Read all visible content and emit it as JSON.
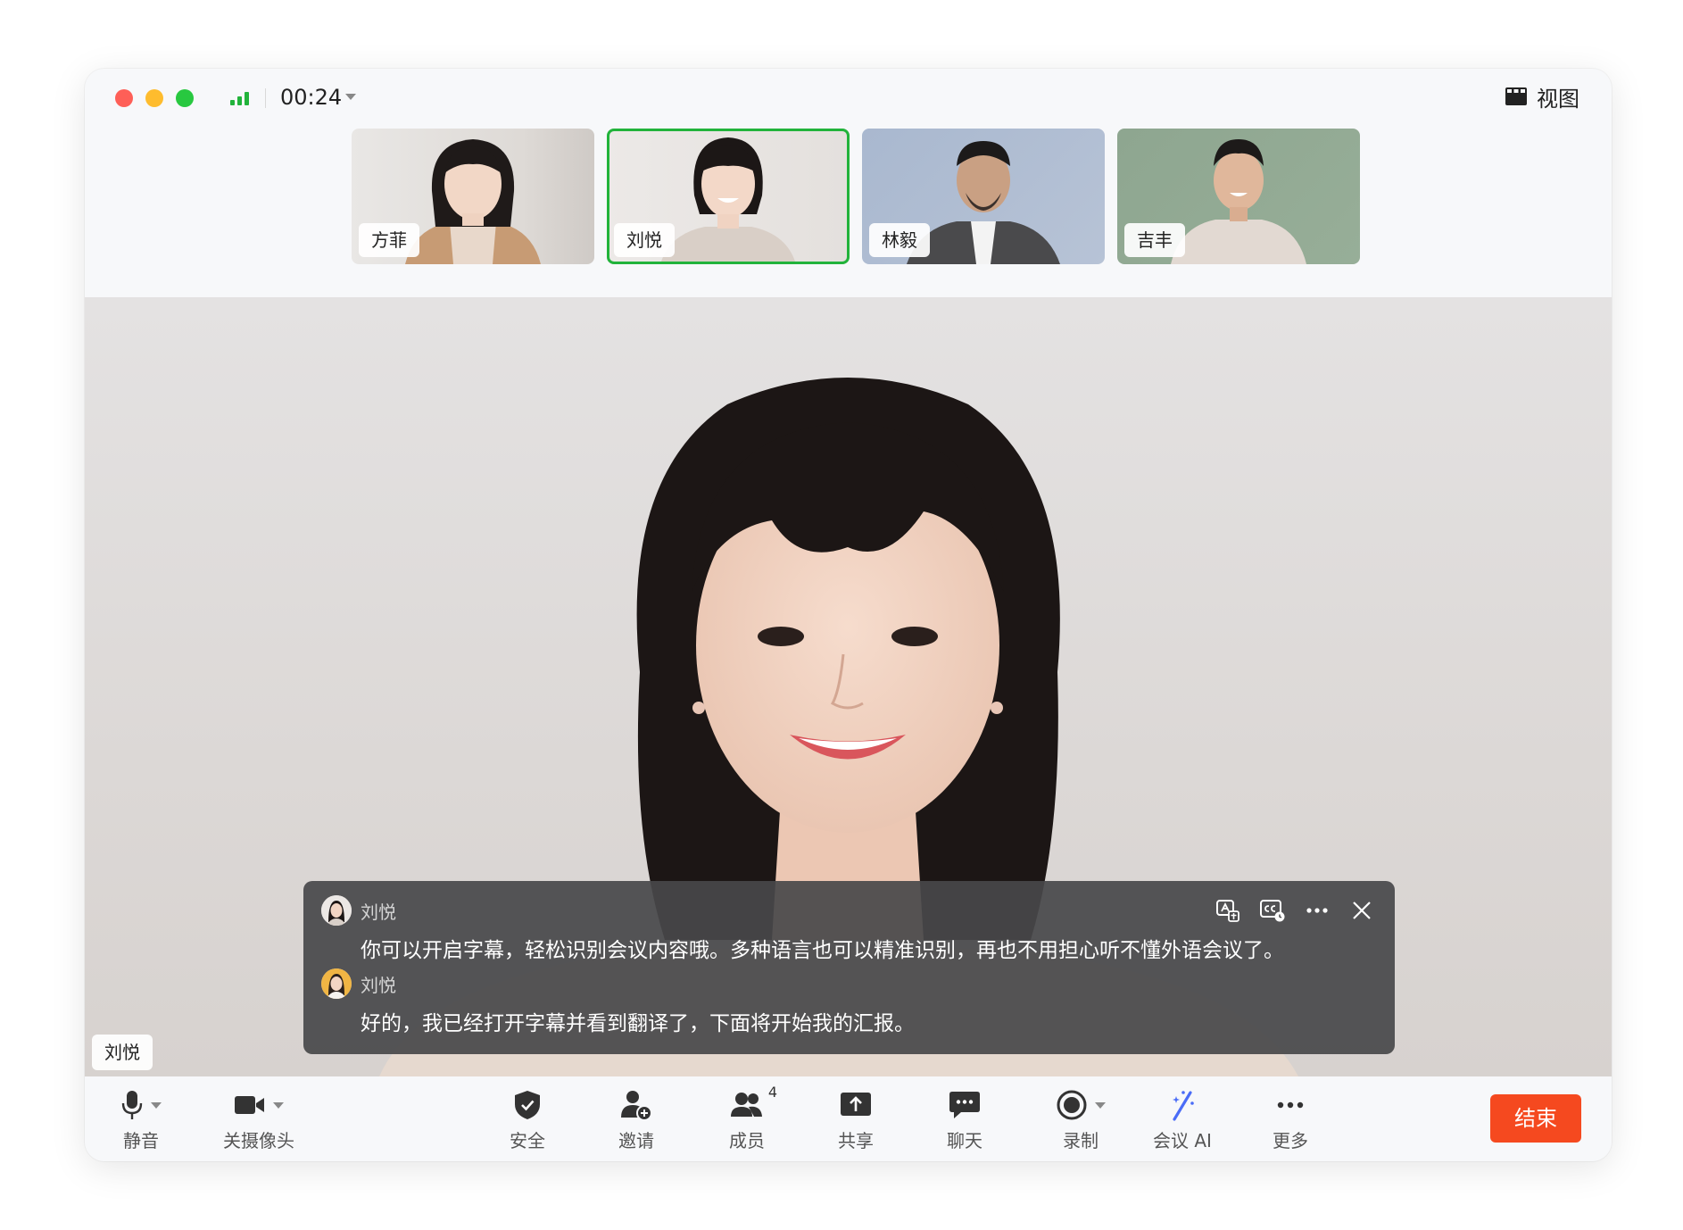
{
  "titlebar": {
    "timer": "00:24",
    "view_label": "视图"
  },
  "participants": [
    {
      "name": "方菲"
    },
    {
      "name": "刘悦"
    },
    {
      "name": "林毅"
    },
    {
      "name": "吉丰"
    }
  ],
  "main_video": {
    "speaker_name": "刘悦"
  },
  "subtitles": {
    "entries": [
      {
        "speaker": "刘悦",
        "text": "你可以开启字幕，轻松识别会议内容哦。多种语言也可以精准识别，再也不用担心听不懂外语会议了。"
      },
      {
        "speaker": "刘悦",
        "text": "好的，我已经打开字幕并看到翻译了，下面将开始我的汇报。"
      }
    ]
  },
  "toolbar": {
    "mute": "静音",
    "camera": "关摄像头",
    "security": "安全",
    "invite": "邀请",
    "members": "成员",
    "members_count": "4",
    "share": "共享",
    "chat": "聊天",
    "record": "录制",
    "meeting_ai": "会议 AI",
    "more": "更多",
    "end": "结束"
  },
  "colors": {
    "active_border": "#22b33b",
    "end_button": "#f5491f",
    "ai_icon": "#4a6cf7"
  }
}
